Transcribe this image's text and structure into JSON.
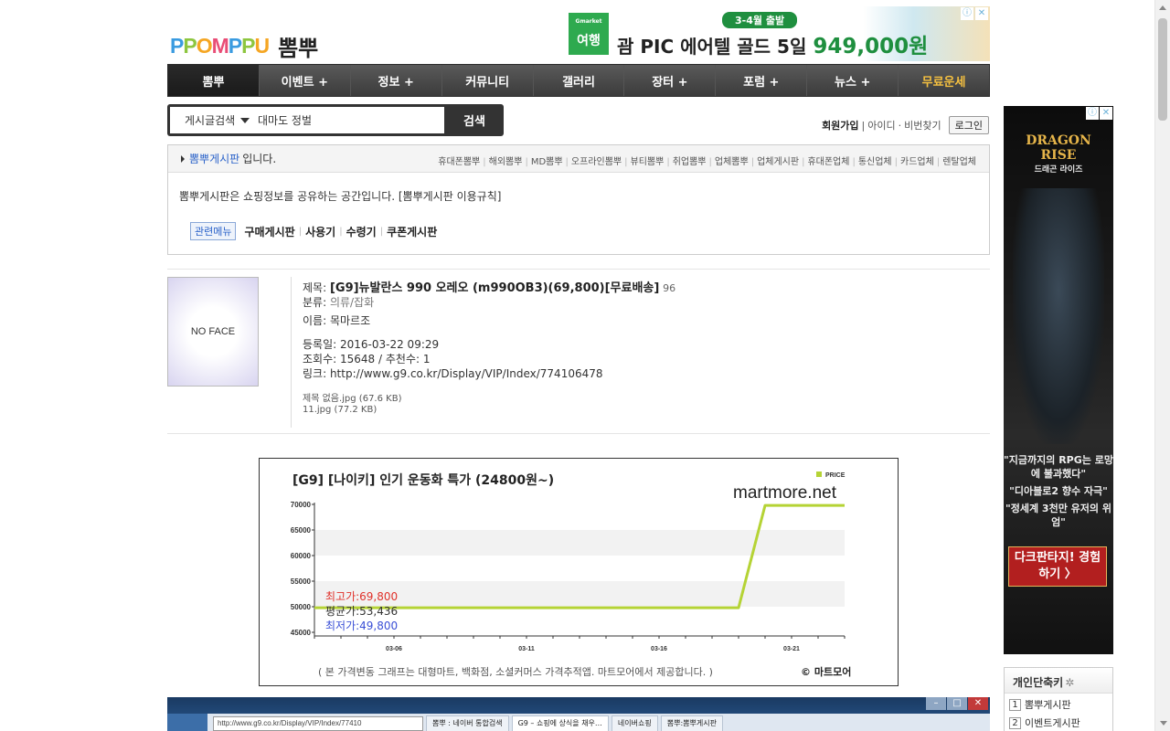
{
  "header": {
    "logo_en": [
      "P",
      "P",
      "O",
      "M",
      "P",
      "P",
      "U"
    ],
    "logo_ko": "뽐뿌"
  },
  "top_ad": {
    "badge_small": "Gmarket",
    "badge": "여행",
    "pill": "3-4월 출발",
    "headline": "괌 PIC 에어텔 골드 5일",
    "price": "949,000원",
    "marks": [
      "ⓘ",
      "✕"
    ]
  },
  "nav": {
    "items": [
      "뽐뿌",
      "이벤트 +",
      "정보 +",
      "커뮤니티",
      "갤러리",
      "장터 +",
      "포럼 +",
      "뉴스 +",
      "무료운세"
    ]
  },
  "search": {
    "select": "게시글검색",
    "value": "대마도 정벌",
    "button": "검색"
  },
  "member": {
    "join": "회원가입",
    "sep": "|",
    "find_id": "아이디",
    "dot": "·",
    "find_pw": "비번찾기",
    "login": "로그인"
  },
  "board": {
    "name": "뽐뿌게시판",
    "suffix": "입니다.",
    "links": [
      "휴대폰뽐뿌",
      "해외뽐뿌",
      "MD뽐뿌",
      "오프라인뽐뿌",
      "뷰티뽐뿌",
      "취업뽐뿌",
      "업체뽐뿌",
      "업체게시판",
      "휴대폰업체",
      "통신업체",
      "카드업체",
      "렌탈업체"
    ],
    "desc": "뽐뿌게시판은 쇼핑정보를 공유하는 공간입니다. [뽐뿌게시판 이용규칙]",
    "related_tag": "관련메뉴",
    "related": [
      "구매게시판",
      "사용기",
      "수령기",
      "쿠폰게시판"
    ]
  },
  "post": {
    "avatar_text": "NO FACE",
    "title_label": "제목:",
    "title": "[G9]뉴발란스 990 오레오 (m990OB3)(69,800)[무료배송]",
    "comment_count": "96",
    "category_label": "분류:",
    "category": "의류/잡화",
    "name_label": "이름:",
    "name": "목마르조",
    "date_label": "등록일:",
    "date": "2016-03-22 09:29",
    "views_label": "조회수:",
    "views": "15648",
    "recommend_label": "/ 추천수:",
    "recommend": "1",
    "link_label": "링크:",
    "link": "http://www.g9.co.kr/Display/VIP/Index/774106478",
    "files": [
      "제목 없음.jpg (67.6 KB)",
      "11.jpg (77.2 KB)"
    ]
  },
  "chart_data": {
    "type": "line",
    "title": "[G9] [나이키] 인기 운동화 특가 (24800원~)",
    "brand": "martmore.net",
    "legend": "PRICE",
    "y_ticks": [
      "70000",
      "65000",
      "60000",
      "55000",
      "50000",
      "45000"
    ],
    "x_ticks": [
      "03-06",
      "03-11",
      "03-16",
      "03-21"
    ],
    "ylim": [
      45000,
      70000
    ],
    "series": [
      {
        "values": [
          {
            "x": "03-03",
            "y": 49800
          },
          {
            "x": "03-19",
            "y": 49800
          },
          {
            "x": "03-20",
            "y": 69800
          },
          {
            "x": "03-23",
            "y": 69800
          }
        ]
      }
    ],
    "max_label": "최고가:69,800",
    "avg_label": "평균가:53,436",
    "min_label": "최저가:49,800",
    "footnote": "( 본 가격변동 그래프는 대형마트, 백화점, 소셜커머스 가격추적앱. 마트모어에서 제공합니다. )",
    "credit": "© 마트모어",
    "colors": {
      "line": "#b5d335",
      "max": "#e0312a",
      "avg": "#333333",
      "min": "#3a4fd6"
    }
  },
  "side_ad": {
    "brand": "DRAGON RISE",
    "brand_ko": "드래곤 라이즈",
    "copy": [
      "\"지금까지의 RPG는 로망에 불과했다\"",
      "\"디아블로2 향수 자극\"",
      "\"정세계 3천만 유저의 위엄\""
    ],
    "cta": "다크판타지! 경험하기 〉"
  },
  "shortcuts": {
    "title": "개인단축키",
    "items": [
      {
        "num": "1",
        "label": "뽐뿌게시판"
      },
      {
        "num": "2",
        "label": "이벤트게시판"
      }
    ]
  },
  "strip": {
    "url": "http://www.g9.co.kr/Display/VIP/Index/77410",
    "tabs": [
      "뽐뿌 : 네이버 통합검색",
      "G9 – 쇼핑에 상식을 채우…",
      "네이버쇼핑",
      "뽐뿌:뽐뿌게시판"
    ]
  }
}
